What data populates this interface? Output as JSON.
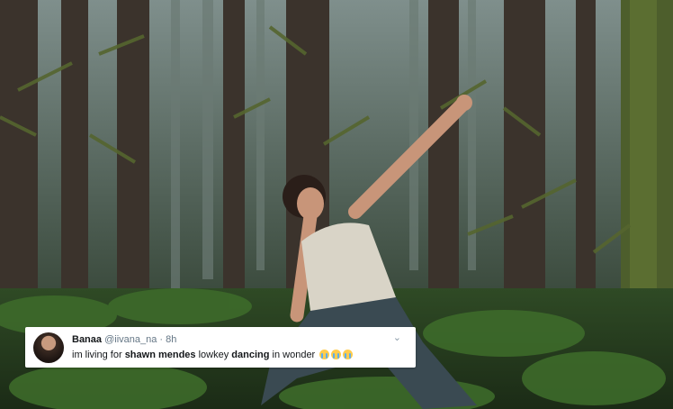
{
  "tweet": {
    "display_name": "Banaa",
    "handle": "@iivana_na",
    "separator": "·",
    "time": "8h",
    "text_before": "im living for ",
    "highlight_1": "shawn mendes",
    "text_middle": " lowkey ",
    "highlight_2": "dancing",
    "text_after": " in wonder",
    "emoji_name": "loudly-crying-face",
    "emoji_count": 3
  },
  "colors": {
    "card_background": "#ffffff",
    "handle_gray": "#657786",
    "forest_dark": "#1f2a22",
    "moss_green": "#5a6b2f"
  }
}
